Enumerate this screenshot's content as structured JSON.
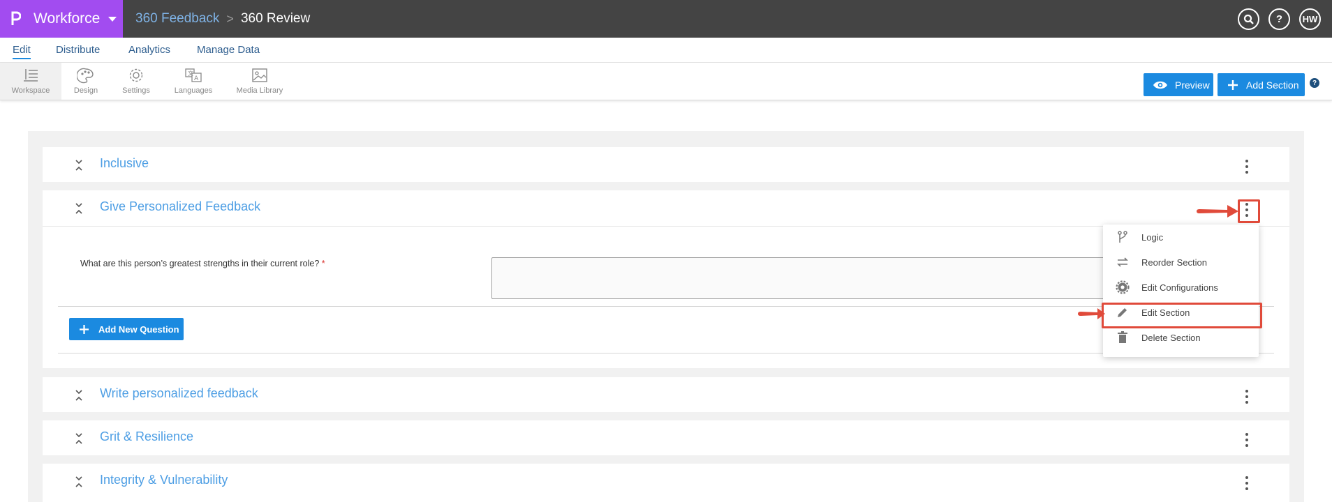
{
  "app": {
    "brand": "Workforce",
    "breadcrumb": {
      "parent": "360 Feedback",
      "separator": ">",
      "current": "360 Review"
    },
    "header_icons": {
      "search": "search-icon",
      "help": "?",
      "user_initials": "HW"
    }
  },
  "menu": {
    "items": [
      "Edit",
      "Distribute",
      "Analytics",
      "Manage Data"
    ]
  },
  "toolbar": {
    "tools": [
      "Workspace",
      "Design",
      "Settings",
      "Languages",
      "Media Library"
    ],
    "preview_label": "Preview",
    "add_section_label": "Add Section",
    "help": "?"
  },
  "sections": [
    {
      "title": "Inclusive"
    },
    {
      "title": "Give Personalized Feedback",
      "question": "What are this person’s greatest strengths in their current role?",
      "required_mark": "*",
      "add_question_label": "Add New Question"
    },
    {
      "title": "Write personalized feedback"
    },
    {
      "title": "Grit & Resilience"
    },
    {
      "title": "Integrity & Vulnerability"
    }
  ],
  "section_menu": {
    "items": [
      "Logic",
      "Reorder Section",
      "Edit Configurations",
      "Edit Section",
      "Delete Section"
    ],
    "highlighted": "Edit Section"
  },
  "colors": {
    "brand": "#a24cf0",
    "topbar": "#444444",
    "accent": "#1b8ae0",
    "section_title": "#4d9ee4",
    "annotation": "#e04a3a"
  }
}
